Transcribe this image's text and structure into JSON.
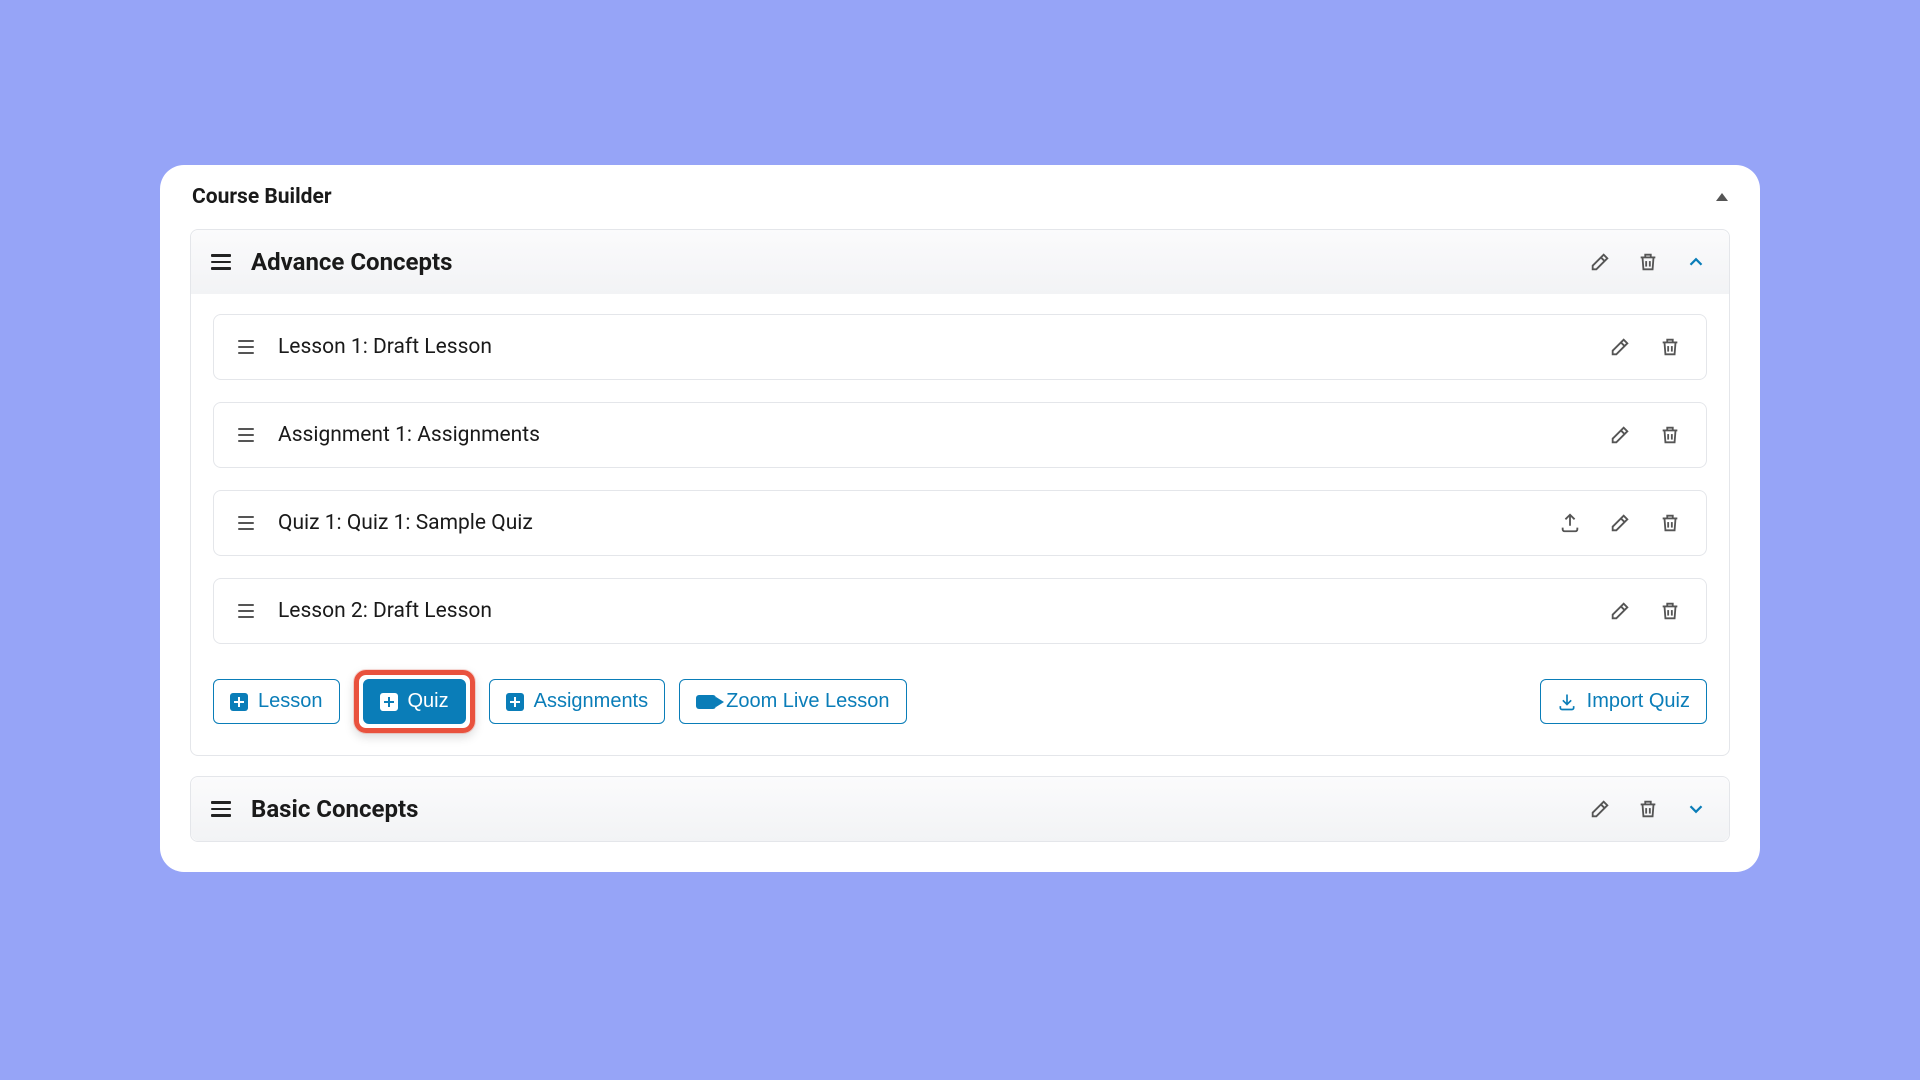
{
  "card": {
    "title": "Course Builder"
  },
  "sections": [
    {
      "title": "Advance Concepts",
      "expanded": true,
      "items": [
        {
          "title": "Lesson 1: Draft Lesson",
          "has_export": false
        },
        {
          "title": "Assignment 1: Assignments",
          "has_export": false
        },
        {
          "title": "Quiz 1: Quiz 1: Sample Quiz",
          "has_export": true
        },
        {
          "title": "Lesson 2: Draft Lesson",
          "has_export": false
        }
      ],
      "actions": {
        "lesson": "Lesson",
        "quiz": "Quiz",
        "assignments": "Assignments",
        "zoom": "Zoom Live Lesson",
        "import_quiz": "Import Quiz"
      },
      "highlighted_action": "quiz"
    },
    {
      "title": "Basic Concepts",
      "expanded": false
    }
  ]
}
